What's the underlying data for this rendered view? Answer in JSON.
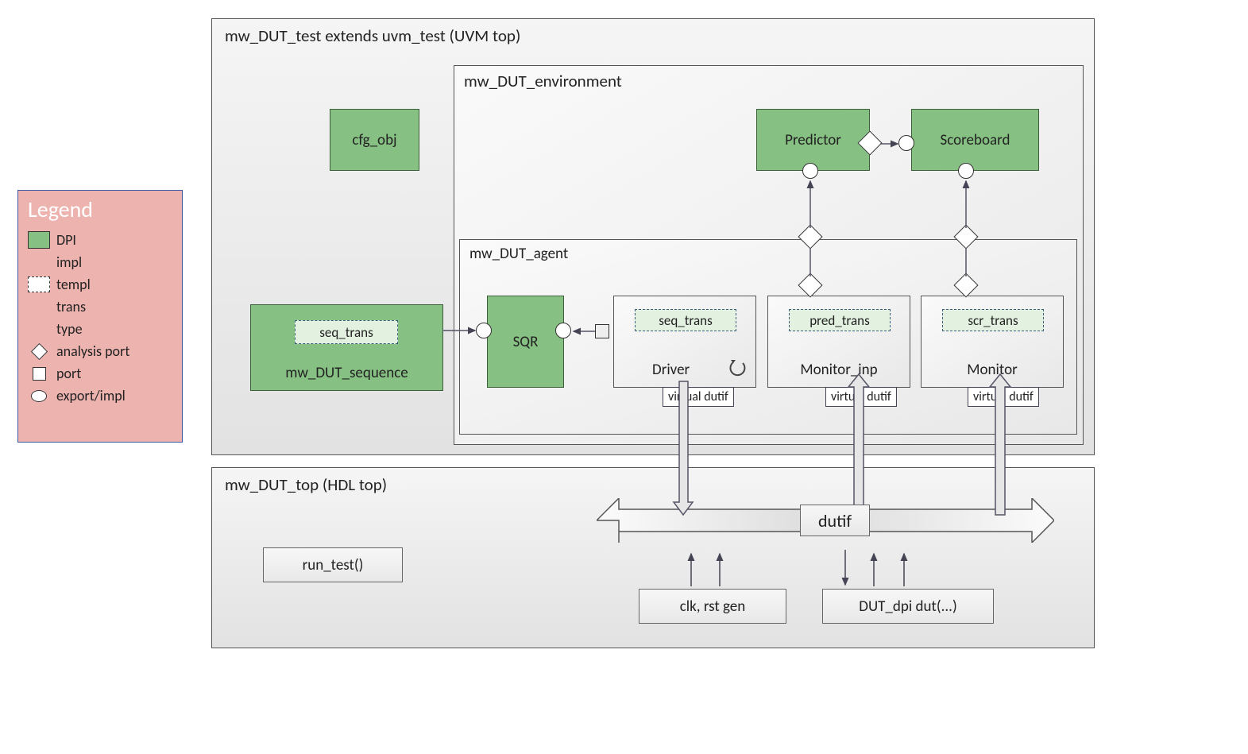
{
  "legend": {
    "title": "Legend",
    "dpi": "DPI",
    "impl": "impl",
    "templ": "templ",
    "trans": "trans",
    "type": "type",
    "analysis": "analysis port",
    "port": "port",
    "export": "export/impl"
  },
  "test": {
    "title": "mw_DUT_test extends uvm_test (UVM top)",
    "cfg": "cfg_obj",
    "sequence": {
      "name": "mw_DUT_sequence",
      "trans": "seq_trans"
    },
    "env": {
      "title": "mw_DUT_environment",
      "predictor": "Predictor",
      "scoreboard": "Scoreboard",
      "agent": {
        "title": "mw_DUT_agent",
        "sqr": "SQR",
        "driver": {
          "name": "Driver",
          "trans": "seq_trans",
          "dutif": "virtual dutif"
        },
        "mon_inp": {
          "name": "Monitor_inp",
          "trans": "pred_trans",
          "dutif": "virtual dutif"
        },
        "mon": {
          "name": "Monitor",
          "trans": "scr_trans",
          "dutif": "virtual dutif"
        }
      }
    }
  },
  "top": {
    "title": "mw_DUT_top  (HDL top)",
    "runtest": "run_test()",
    "dutif": "dutif",
    "clk": "clk, rst gen",
    "dut": "DUT_dpi dut(...)"
  }
}
